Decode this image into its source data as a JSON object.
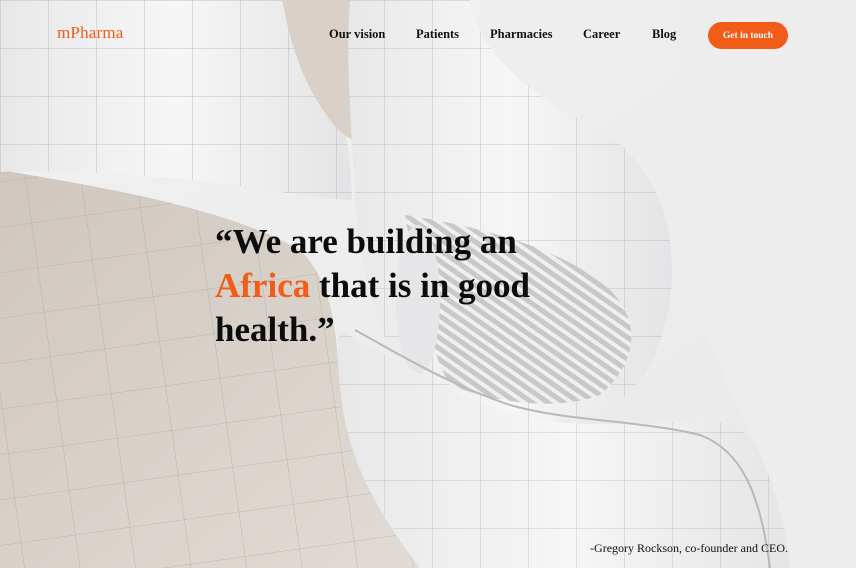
{
  "header": {
    "logo": "mPharma",
    "nav": [
      {
        "label": "Our vision"
      },
      {
        "label": "Patients"
      },
      {
        "label": "Pharmacies"
      },
      {
        "label": "Career"
      },
      {
        "label": "Blog"
      }
    ],
    "cta_label": "Get in touch"
  },
  "hero": {
    "quote_open": "“We are building an",
    "quote_accent": "Africa",
    "quote_mid": " that is in good",
    "quote_close": "health.”",
    "attribution": "-Gregory Rockson, co-founder and CEO."
  },
  "colors": {
    "accent": "#f25c19",
    "text": "#0c0c0c",
    "background": "#ecebea"
  },
  "icons": []
}
